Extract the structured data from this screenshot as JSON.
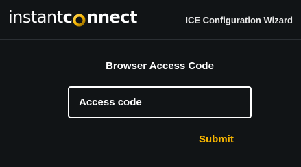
{
  "header": {
    "logo_text_left": "instant",
    "logo_text_right": "nnect",
    "logo_text_full": "instantconnect",
    "title": "ICE Configuration Wizard"
  },
  "form": {
    "title": "Browser Access Code",
    "access_code": {
      "value": "",
      "placeholder": "Access code"
    },
    "submit_label": "Submit"
  },
  "colors": {
    "background": "#111416",
    "accent": "#f5b400",
    "text": "#ffffff"
  },
  "icons": {
    "logo_mark": "connect-ring-icon"
  }
}
